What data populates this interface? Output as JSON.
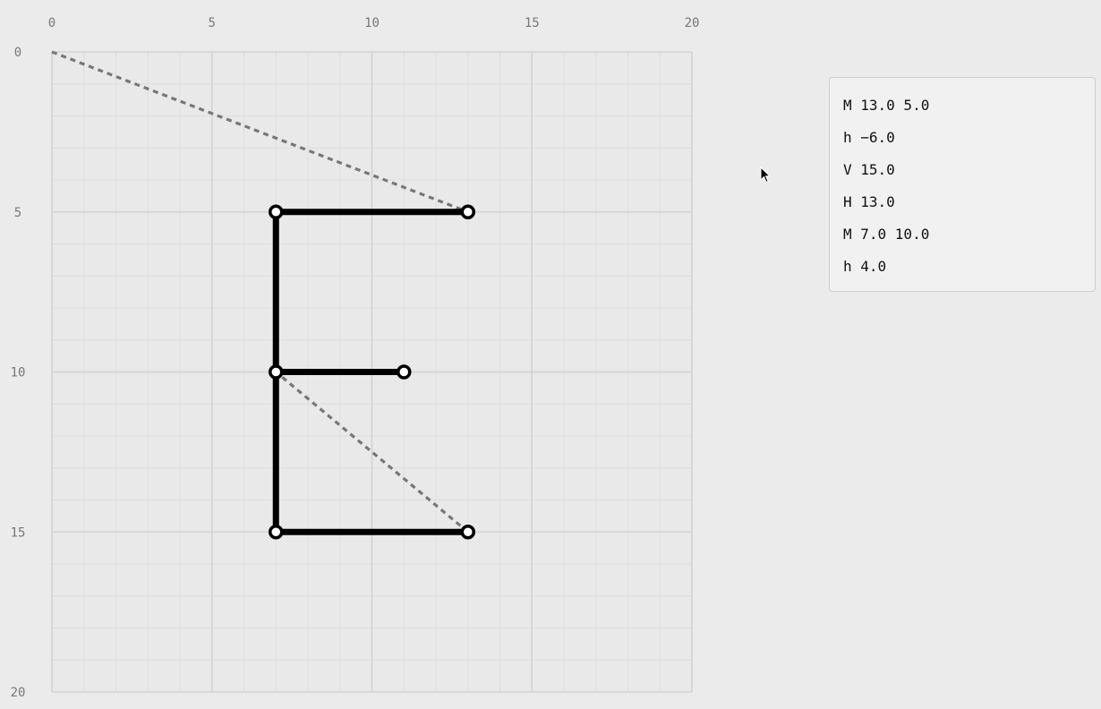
{
  "grid": {
    "x_ticks": [
      "0",
      "5",
      "10",
      "15",
      "20"
    ],
    "y_ticks": [
      "0",
      "5",
      "10",
      "15",
      "20"
    ],
    "range": [
      0,
      20
    ],
    "minor_step": 1,
    "major_step": 5,
    "colors": {
      "background": "#ebebeb",
      "minor_line": "#dedede",
      "major_line": "#d2d2d2",
      "tick_label": "#777777"
    }
  },
  "path": {
    "color": "#000000",
    "segments": [
      {
        "from": [
          13,
          5
        ],
        "to": [
          7,
          5
        ]
      },
      {
        "from": [
          7,
          5
        ],
        "to": [
          7,
          15
        ]
      },
      {
        "from": [
          7,
          15
        ],
        "to": [
          13,
          15
        ]
      },
      {
        "from": [
          7,
          10
        ],
        "to": [
          11,
          10
        ]
      }
    ],
    "control_points": [
      [
        13,
        5
      ],
      [
        7,
        5
      ],
      [
        7,
        10
      ],
      [
        11,
        10
      ],
      [
        7,
        15
      ],
      [
        13,
        15
      ]
    ],
    "moves": [
      {
        "from": [
          0,
          0
        ],
        "to": [
          13,
          5
        ]
      },
      {
        "from": [
          13,
          15
        ],
        "to": [
          7,
          10
        ]
      }
    ],
    "move_color": "#777777"
  },
  "commands": [
    "M 13.0 5.0",
    "h −6.0",
    "V 15.0",
    "H 13.0",
    "M 7.0 10.0",
    "h 4.0"
  ],
  "cursor": {
    "icon": "arrow-pointer-icon"
  }
}
